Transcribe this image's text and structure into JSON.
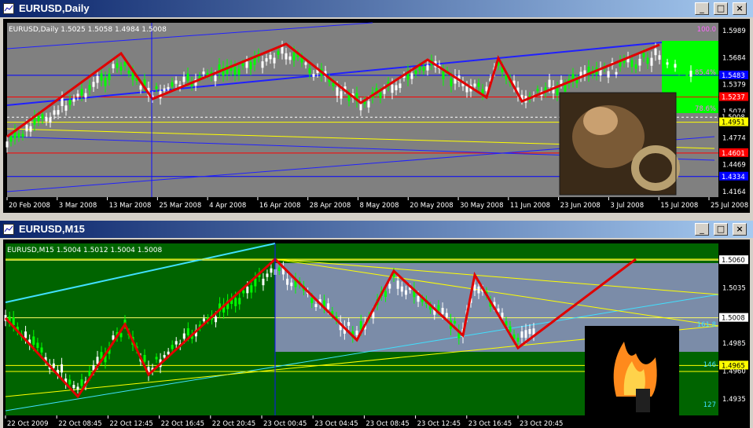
{
  "window1": {
    "title": "EURUSD,Daily",
    "header": "EURUSD,Daily  1.5025 1.5058 1.4984 1.5008",
    "price_labels": [
      "1.5989",
      "1.5684",
      "1.5379",
      "1.5074",
      "1.4774",
      "1.4469",
      "1.4164"
    ],
    "price_tags": [
      {
        "text": "1.5483",
        "y": 1.5483,
        "bg": "#0000ff",
        "fg": "#ffffff"
      },
      {
        "text": "1.5237",
        "y": 1.5237,
        "bg": "#ff0000",
        "fg": "#ffffff"
      },
      {
        "text": "1.5008",
        "y": 1.5008,
        "bg": "#000000",
        "fg": "#ffffff"
      },
      {
        "text": "1.4951",
        "y": 1.4951,
        "bg": "#ffff00",
        "fg": "#000000"
      },
      {
        "text": "1.4601",
        "y": 1.4601,
        "bg": "#ff0000",
        "fg": "#ffffff"
      },
      {
        "text": "1.4334",
        "y": 1.4334,
        "bg": "#0000ff",
        "fg": "#ffffff"
      }
    ],
    "fib_labels": [
      {
        "text": "100.0",
        "y": 1.601
      },
      {
        "text": "85.4%",
        "y": 1.552
      },
      {
        "text": "78.6%",
        "y": 1.511
      }
    ],
    "time_labels": [
      "20 Feb 2008",
      "3 Mar 2008",
      "13 Mar 2008",
      "25 Mar 2008",
      "4 Apr 2008",
      "16 Apr 2008",
      "28 Apr 2008",
      "8 May 2008",
      "20 May 2008",
      "30 May 2008",
      "11 Jun 2008",
      "23 Jun 2008",
      "3 Jul 2008",
      "15 Jul 2008",
      "25 Jul 2008"
    ]
  },
  "window2": {
    "title": "EURUSD,M15",
    "header": "EURUSD,M15  1.5004 1.5012 1.5004 1.5008",
    "price_labels": [
      "1.5035",
      "1.5008",
      "1.4985",
      "1.4960",
      "1.4935"
    ],
    "price_tags": [
      {
        "text": "1.5060",
        "y": 1.506,
        "bg": "#ffffff",
        "fg": "#000000"
      },
      {
        "text": "1.5008",
        "y": 1.5008,
        "bg": "#ffffff",
        "fg": "#000000"
      },
      {
        "text": "1.4965",
        "y": 1.4965,
        "bg": "#ffff00",
        "fg": "#000000"
      }
    ],
    "fib_labels": [
      {
        "text": "161.8",
        "y": 1.5002
      },
      {
        "text": "146",
        "y": 1.4966
      },
      {
        "text": "127",
        "y": 1.493
      }
    ],
    "time_labels": [
      "22 Oct 2009",
      "22 Oct 08:45",
      "22 Oct 12:45",
      "22 Oct 16:45",
      "22 Oct 20:45",
      "23 Oct 00:45",
      "23 Oct 04:45",
      "23 Oct 08:45",
      "23 Oct 12:45",
      "23 Oct 16:45",
      "23 Oct 20:45"
    ]
  },
  "buttons": {
    "minimize": "_",
    "maximize": "□",
    "close": "×"
  },
  "colors": {
    "title_start": "#0a246a",
    "title_end": "#a6caf0",
    "chart1_bg": "#808080",
    "chart2_bg_left": "#006400",
    "chart2_bg_right": "#7b8ca8",
    "zigzag": "#e00000",
    "bull_candle": "#00ff00"
  }
}
